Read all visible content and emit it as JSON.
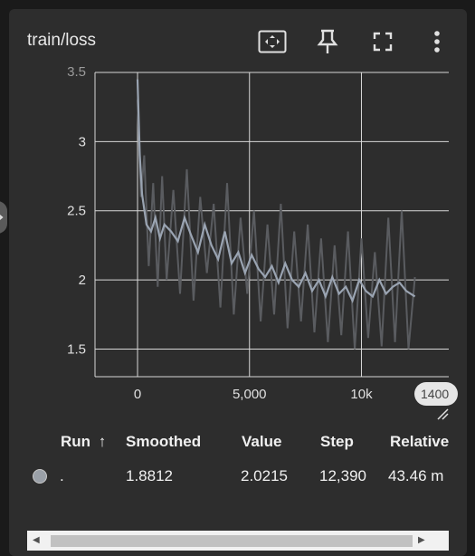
{
  "card": {
    "title": "train/loss",
    "toolbar": {
      "fit_icon": "fit-domain-icon",
      "pin_icon": "pin-icon",
      "fullscreen_icon": "fullscreen-icon",
      "more_icon": "more-vert-icon"
    }
  },
  "chart_data": {
    "type": "line",
    "title": "",
    "xlabel": "",
    "ylabel": "",
    "xlim": [
      -1900,
      13900
    ],
    "ylim": [
      1.3,
      3.5
    ],
    "x_ticks": [
      "0",
      "5,000",
      "10k"
    ],
    "y_ticks": [
      "1.5",
      "2",
      "2.5",
      "3"
    ],
    "y_tick_values": [
      1.5,
      2,
      2.5,
      3
    ],
    "x_tick_values": [
      0,
      5000,
      10000
    ],
    "y_top_partial_tick": "3.5",
    "grid": true,
    "x_axis_badge": "1400",
    "series": [
      {
        "kind": "smoothed",
        "color": "#9aa4b2",
        "x": [
          0,
          100,
          200,
          400,
          600,
          800,
          1000,
          1200,
          1500,
          1800,
          2100,
          2400,
          2700,
          3000,
          3300,
          3600,
          3900,
          4200,
          4500,
          4800,
          5100,
          5400,
          5700,
          6000,
          6300,
          6600,
          6900,
          7200,
          7500,
          7800,
          8100,
          8400,
          8700,
          9000,
          9300,
          9600,
          9900,
          10200,
          10500,
          10800,
          11100,
          11400,
          11700,
          12000,
          12390
        ],
        "y": [
          3.45,
          2.9,
          2.62,
          2.4,
          2.35,
          2.45,
          2.3,
          2.4,
          2.35,
          2.28,
          2.45,
          2.32,
          2.2,
          2.4,
          2.25,
          2.15,
          2.35,
          2.12,
          2.2,
          2.05,
          2.18,
          2.08,
          2.02,
          2.1,
          1.98,
          2.12,
          2.0,
          1.95,
          2.05,
          1.92,
          2.0,
          1.88,
          2.02,
          1.9,
          1.95,
          1.85,
          2.0,
          1.92,
          1.88,
          2.0,
          1.9,
          1.95,
          1.98,
          1.92,
          1.88
        ]
      },
      {
        "kind": "raw",
        "color": "#5a5c60",
        "x": [
          0,
          150,
          300,
          500,
          700,
          900,
          1100,
          1300,
          1600,
          1900,
          2200,
          2500,
          2800,
          3100,
          3400,
          3700,
          4000,
          4300,
          4600,
          4900,
          5200,
          5500,
          5800,
          6100,
          6400,
          6700,
          7000,
          7300,
          7600,
          7900,
          8200,
          8500,
          8800,
          9100,
          9400,
          9700,
          10000,
          10300,
          10600,
          10900,
          11200,
          11500,
          11800,
          12100,
          12390
        ],
        "y": [
          3.3,
          2.6,
          2.9,
          2.1,
          2.7,
          1.95,
          2.75,
          2.0,
          2.65,
          1.9,
          2.8,
          1.85,
          2.6,
          2.05,
          2.55,
          1.8,
          2.7,
          1.75,
          2.45,
          1.9,
          2.5,
          1.7,
          2.4,
          1.75,
          2.55,
          1.65,
          2.35,
          1.7,
          2.4,
          1.62,
          2.3,
          1.55,
          2.25,
          1.6,
          2.35,
          1.5,
          2.3,
          1.58,
          2.2,
          1.52,
          2.45,
          1.55,
          2.5,
          1.5,
          2.02
        ]
      }
    ]
  },
  "table": {
    "headers": {
      "run": "Run",
      "run_sort_icon": "arrow-up-icon",
      "smoothed": "Smoothed",
      "value": "Value",
      "step": "Step",
      "relative": "Relative"
    },
    "row": {
      "run": ".",
      "smoothed": "1.8812",
      "value": "2.0215",
      "step": "12,390",
      "relative": "43.46 m"
    }
  },
  "scrollbar": {
    "left_arrow": "◀",
    "right_arrow": "▶"
  }
}
